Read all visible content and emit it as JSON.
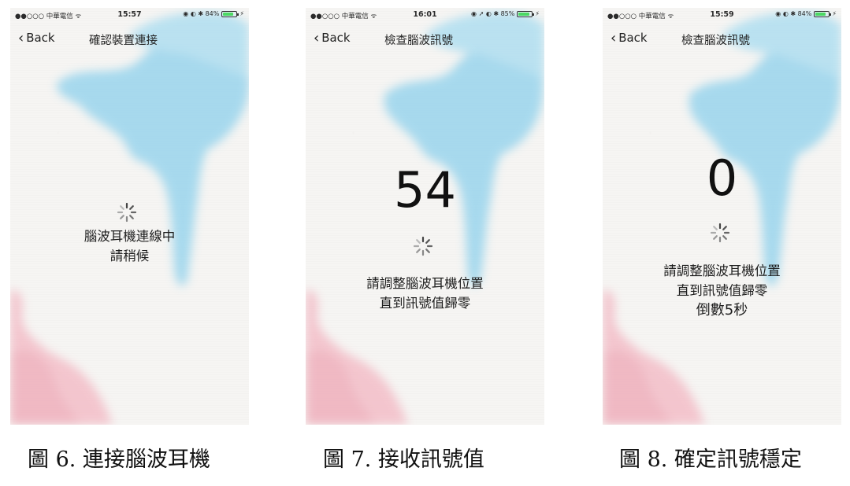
{
  "screens": [
    {
      "status": {
        "carrier": "●●○○○ 中華電信 ᯤ",
        "time": "15:57",
        "icons": "◉ ◐ ✱ 84%",
        "battery_level": 0.84
      },
      "nav": {
        "back_label": "Back",
        "title": "確認裝置連接"
      },
      "number": "",
      "message": [
        "腦波耳機連線中",
        "請稍候"
      ],
      "caption": "圖 6.  連接腦波耳機"
    },
    {
      "status": {
        "carrier": "●●○○○ 中華電信 ᯤ",
        "time": "16:01",
        "icons": "◉ ➚ ◐ ✱ 85%",
        "battery_level": 0.85
      },
      "nav": {
        "back_label": "Back",
        "title": "檢查腦波訊號"
      },
      "number": "54",
      "message": [
        "請調整腦波耳機位置",
        "直到訊號值歸零"
      ],
      "caption": "圖 7.  接收訊號值"
    },
    {
      "status": {
        "carrier": "●●○○○ 中華電信 ᯤ",
        "time": "15:59",
        "icons": "◉ ◐ ✱ 84%",
        "battery_level": 0.84
      },
      "nav": {
        "back_label": "Back",
        "title": "檢查腦波訊號"
      },
      "number": "0",
      "message": [
        "請調整腦波耳機位置",
        "直到訊號值歸零",
        "倒數5秒"
      ],
      "caption": "圖 8.  確定訊號穩定"
    }
  ],
  "colors": {
    "blue_wash": "#7fcbea",
    "pink_wash": "#f2aab8",
    "paper": "#f6f5f3"
  }
}
